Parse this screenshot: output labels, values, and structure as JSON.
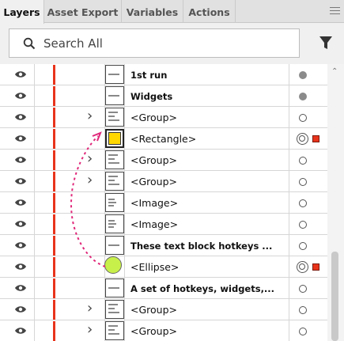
{
  "tabs": [
    {
      "label": "Layers",
      "active": true
    },
    {
      "label": "Asset Export",
      "active": false
    },
    {
      "label": "Variables",
      "active": false
    },
    {
      "label": "Actions",
      "active": false
    }
  ],
  "search": {
    "placeholder": "Search All",
    "value": ""
  },
  "colors": {
    "layer_color": "#e8331b",
    "rectangle_fill": "#ffd700",
    "ellipse_fill": "#c8f04a",
    "arrow": "#e0287a"
  },
  "rows": [
    {
      "name": "1st run",
      "bold": true,
      "expandable": false,
      "thumb": "text",
      "target": "filled",
      "selected": false
    },
    {
      "name": "Widgets",
      "bold": true,
      "expandable": false,
      "thumb": "text",
      "target": "filled",
      "selected": false
    },
    {
      "name": "<Group>",
      "bold": false,
      "expandable": true,
      "thumb": "group",
      "target": "hollow",
      "selected": false
    },
    {
      "name": "<Rectangle>",
      "bold": false,
      "expandable": false,
      "thumb": "rectangle",
      "target": "double",
      "selected": true
    },
    {
      "name": "<Group>",
      "bold": false,
      "expandable": true,
      "thumb": "group",
      "target": "hollow",
      "selected": false
    },
    {
      "name": "<Group>",
      "bold": false,
      "expandable": true,
      "thumb": "group",
      "target": "hollow",
      "selected": false
    },
    {
      "name": "<Image>",
      "bold": false,
      "expandable": false,
      "thumb": "image",
      "target": "hollow",
      "selected": false
    },
    {
      "name": "<Image>",
      "bold": false,
      "expandable": false,
      "thumb": "image",
      "target": "hollow",
      "selected": false
    },
    {
      "name": "These text block hotkeys ...",
      "bold": true,
      "expandable": false,
      "thumb": "text",
      "target": "hollow",
      "selected": false
    },
    {
      "name": "<Ellipse>",
      "bold": false,
      "expandable": false,
      "thumb": "ellipse",
      "target": "double",
      "selected": true
    },
    {
      "name": "A set of hotkeys, widgets,...",
      "bold": true,
      "expandable": false,
      "thumb": "text",
      "target": "hollow",
      "selected": false
    },
    {
      "name": "<Group>",
      "bold": false,
      "expandable": true,
      "thumb": "group",
      "target": "hollow",
      "selected": false
    },
    {
      "name": "<Group>",
      "bold": false,
      "expandable": true,
      "thumb": "group",
      "target": "hollow",
      "selected": false
    }
  ]
}
